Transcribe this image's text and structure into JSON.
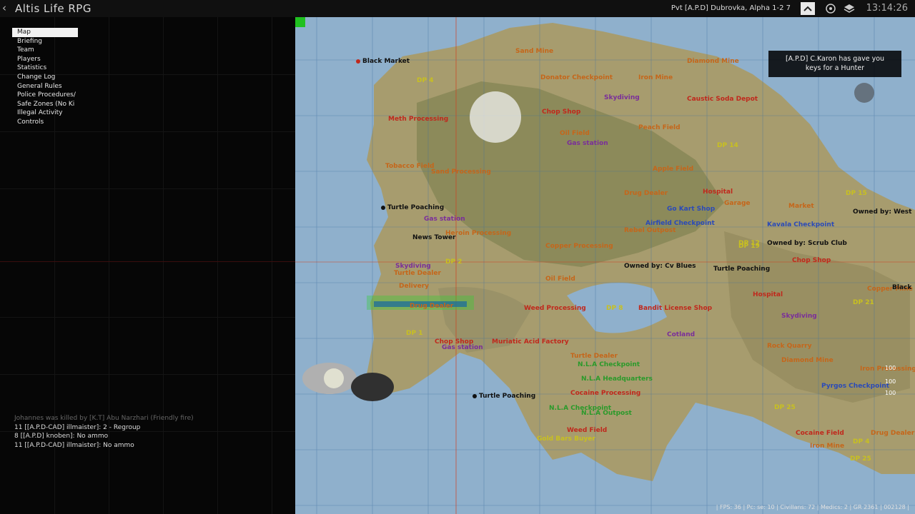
{
  "app": {
    "title": "Altis Life RPG",
    "player": "Pvt [A.P.D] Dubrovka, Alpha 1-2 7",
    "clock": "13:14:26"
  },
  "menu": {
    "items": [
      {
        "label": "Map",
        "selected": true
      },
      {
        "label": "Briefing"
      },
      {
        "label": "Team"
      },
      {
        "label": "Players"
      },
      {
        "label": "Statistics"
      },
      {
        "label": "Change Log"
      },
      {
        "label": "General Rules"
      },
      {
        "label": "Police Procedures/"
      },
      {
        "label": "Safe Zones (No Ki"
      },
      {
        "label": "Illegal Activity"
      },
      {
        "label": "Controls"
      }
    ]
  },
  "chat": [
    "Johannes was killed by [K.T] Abu Narzhari (Friendly fire)",
    "11 [[A.P.D-CAD] illmaister]: 2 - Regroup",
    "8 [[A.P.D] knoben]: No ammo",
    "11 [[A.P.D-CAD] illmaister]: No ammo"
  ],
  "notification": {
    "line1": "[A.P.D] C.Karon has gave you",
    "line2": "keys for a Hunter"
  },
  "status_bar": "| FPS: 36 | Pc: se: 10 | Civillans: 72 | Medics: 2 | GR 2361 | 002128 |",
  "side_numbers": [
    "100",
    "100",
    "100"
  ],
  "map_labels": [
    {
      "text": "Black Market",
      "cls": "ml-black",
      "pin": "#c0281c"
    },
    {
      "text": "Sand Mine",
      "cls": "ml-orange"
    },
    {
      "text": "Diamond Mine",
      "cls": "ml-orange"
    },
    {
      "text": "DP 4",
      "cls": "ml-yellow"
    },
    {
      "text": "Donator Checkpoint",
      "cls": "ml-orange"
    },
    {
      "text": "Iron Mine",
      "cls": "ml-orange"
    },
    {
      "text": "Skydiving",
      "cls": "ml-purple"
    },
    {
      "text": "Caustic Soda Depot",
      "cls": "ml-red"
    },
    {
      "text": "Meth Processing",
      "cls": "ml-red"
    },
    {
      "text": "Chop Shop",
      "cls": "ml-red"
    },
    {
      "text": "Oil Field",
      "cls": "ml-orange"
    },
    {
      "text": "Gas station",
      "cls": "ml-purple"
    },
    {
      "text": "Peach Field",
      "cls": "ml-orange"
    },
    {
      "text": "DP 14",
      "cls": "ml-yellow"
    },
    {
      "text": "Tobacco Field",
      "cls": "ml-orange"
    },
    {
      "text": "Sand Processing",
      "cls": "ml-orange"
    },
    {
      "text": "Apple Field",
      "cls": "ml-orange"
    },
    {
      "text": "Drug Dealer",
      "cls": "ml-orange"
    },
    {
      "text": "Hospital",
      "cls": "ml-red"
    },
    {
      "text": "Market",
      "cls": "ml-orange"
    },
    {
      "text": "Garage",
      "cls": "ml-orange"
    },
    {
      "text": "DP 15",
      "cls": "ml-yellow"
    },
    {
      "text": "Owned by: West",
      "cls": "ml-black"
    },
    {
      "text": "Turtle Poaching",
      "cls": "ml-black",
      "pin": "#111"
    },
    {
      "text": "Go Kart Shop",
      "cls": "ml-blue"
    },
    {
      "text": "Airfield Checkpoint",
      "cls": "ml-blue"
    },
    {
      "text": "Gas station",
      "cls": "ml-purple"
    },
    {
      "text": "DP 2",
      "cls": "ml-yellow"
    },
    {
      "text": "Kavala Checkpoint",
      "cls": "ml-blue"
    },
    {
      "text": "Rebel Outpost",
      "cls": "ml-orange"
    },
    {
      "text": "DP 12",
      "cls": "ml-yellow"
    },
    {
      "text": "Heroin Processing",
      "cls": "ml-orange"
    },
    {
      "text": "Owned by: Scrub Club",
      "cls": "ml-black"
    },
    {
      "text": "News Tower",
      "cls": "ml-black"
    },
    {
      "text": "Copper Processing",
      "cls": "ml-orange"
    },
    {
      "text": "DP 19",
      "cls": "ml-yellow"
    },
    {
      "text": "Chop Shop",
      "cls": "ml-red"
    },
    {
      "text": "Owned by: Cv Blues",
      "cls": "ml-black"
    },
    {
      "text": "Turtle Poaching",
      "cls": "ml-black"
    },
    {
      "text": "Skydiving",
      "cls": "ml-purple"
    },
    {
      "text": "Turtle Dealer",
      "cls": "ml-orange"
    },
    {
      "text": "Copper Mine",
      "cls": "ml-orange"
    },
    {
      "text": "Black",
      "cls": "ml-black"
    },
    {
      "text": "Delivery",
      "cls": "ml-orange"
    },
    {
      "text": "Oil Field",
      "cls": "ml-orange"
    },
    {
      "text": "Hospital",
      "cls": "ml-red"
    },
    {
      "text": "Weed Processing",
      "cls": "ml-red"
    },
    {
      "text": "DP 8",
      "cls": "ml-yellow"
    },
    {
      "text": "Bandit License Shop",
      "cls": "ml-red"
    },
    {
      "text": "DP 21",
      "cls": "ml-yellow"
    },
    {
      "text": "Drug Dealer",
      "cls": "ml-orange"
    },
    {
      "text": "Skydiving",
      "cls": "ml-purple"
    },
    {
      "text": "Cotland",
      "cls": "ml-purple"
    },
    {
      "text": "DP 1",
      "cls": "ml-yellow"
    },
    {
      "text": "Chop Shop",
      "cls": "ml-red"
    },
    {
      "text": "Gas station",
      "cls": "ml-purple"
    },
    {
      "text": "Muriatic Acid Factory",
      "cls": "ml-red"
    },
    {
      "text": "Turtle Dealer",
      "cls": "ml-orange"
    },
    {
      "text": "Rock Quarry",
      "cls": "ml-orange"
    },
    {
      "text": "N.L.A Checkpoint",
      "cls": "ml-green"
    },
    {
      "text": "Diamond Mine",
      "cls": "ml-orange"
    },
    {
      "text": "N.L.A Headquarters",
      "cls": "ml-green"
    },
    {
      "text": "Iron Processing",
      "cls": "ml-orange"
    },
    {
      "text": "Turtle Poaching",
      "cls": "ml-black",
      "pin": "#111"
    },
    {
      "text": "Cocaine Processing",
      "cls": "ml-red"
    },
    {
      "text": "Pyrgos Checkpoint",
      "cls": "ml-blue"
    },
    {
      "text": "N.L.A Checkpoint",
      "cls": "ml-green"
    },
    {
      "text": "N.L.A Outpost",
      "cls": "ml-green"
    },
    {
      "text": "DP 25",
      "cls": "ml-yellow"
    },
    {
      "text": "Weed Field",
      "cls": "ml-red"
    },
    {
      "text": "Gold Bars Buyer",
      "cls": "ml-yellow"
    },
    {
      "text": "DP 25",
      "cls": "ml-yellow"
    },
    {
      "text": "Cocaine Field",
      "cls": "ml-red"
    },
    {
      "text": "Iron Mine",
      "cls": "ml-orange"
    },
    {
      "text": "Drug Dealer",
      "cls": "ml-orange"
    },
    {
      "text": "DP 4",
      "cls": "ml-yellow"
    }
  ]
}
